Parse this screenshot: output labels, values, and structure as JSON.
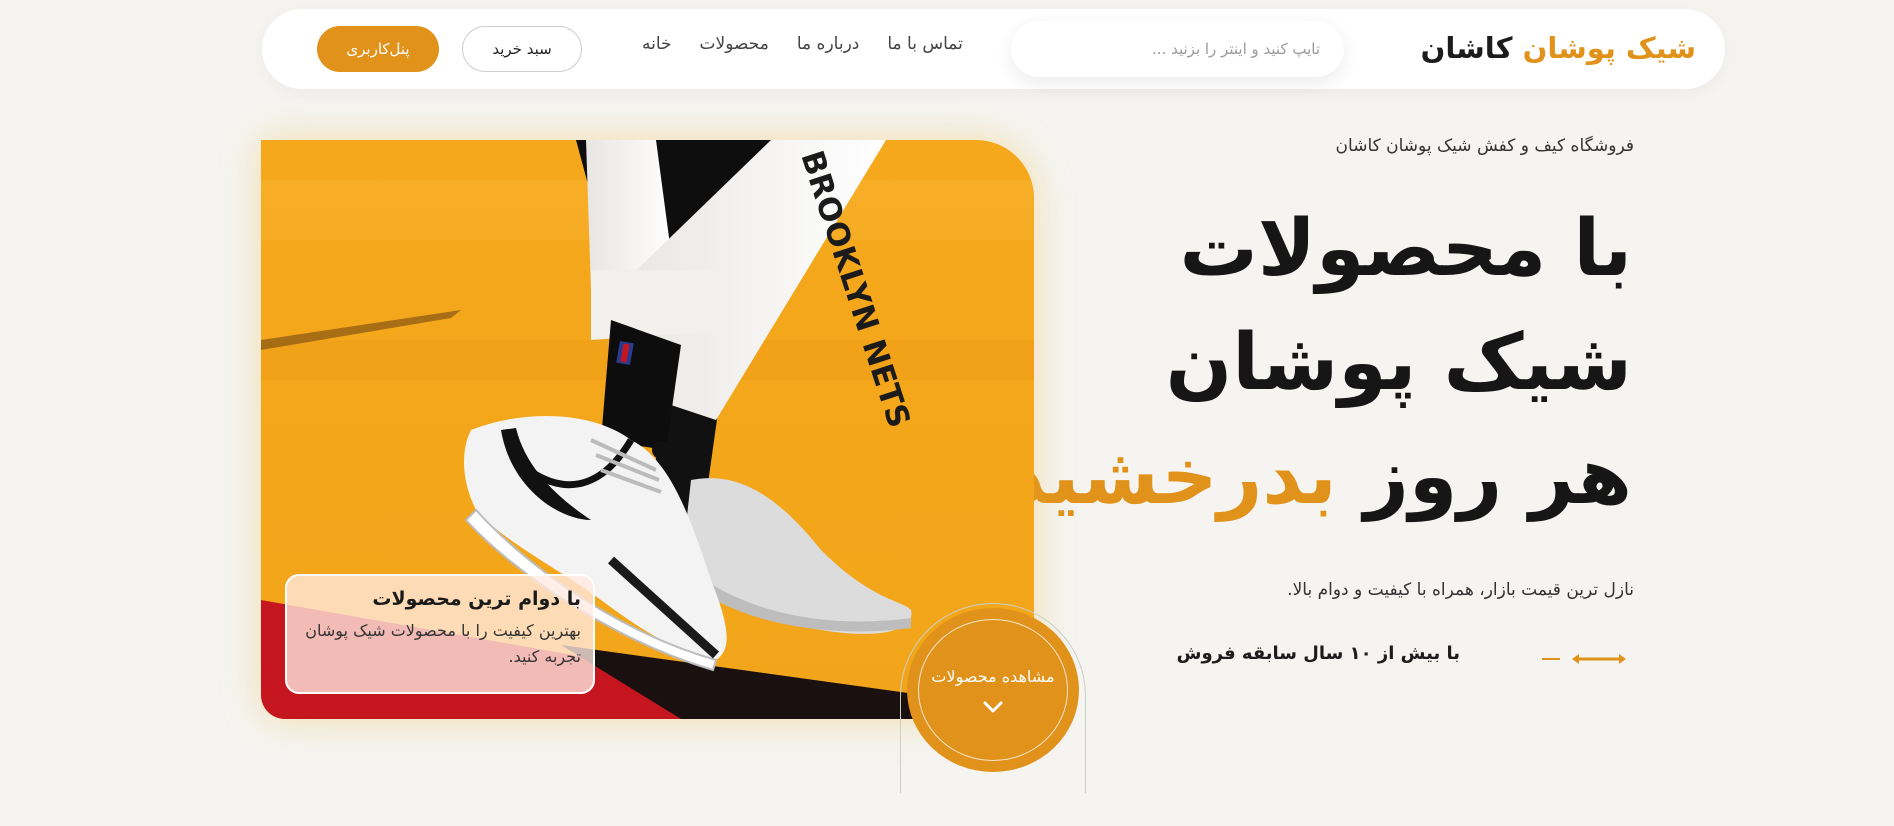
{
  "header": {
    "logo_accent": "شیک پوشان",
    "logo_rest": "کاشان",
    "search_placeholder": "تایپ کنید و اینتر را بزنید ...",
    "nav": [
      "خانه",
      "محصولات",
      "درباره ما",
      "تماس با ما"
    ],
    "cart_label": "سبد خرید",
    "panel_label": "پنل‌کاربری"
  },
  "hero": {
    "kicker": "فروشگاه کیف و کفش شیک پوشان کاشان",
    "headline_line1": "با محصولات",
    "headline_line2": "شیک پوشان",
    "headline_line3_plain": "هر روز",
    "headline_line3_accent": "بدرخشید",
    "headline_dot": ".",
    "subtext": "نازل ترین قیمت بازار، همراه با کیفیت و دوام بالا.",
    "years": "با بیش از ۱۰ سال سابقه فروش",
    "card_title": "با دوام ترین محصولات",
    "card_desc": "بهترین کیفیت را با محصولات شیک پوشان تجربه کنید.",
    "cta_label": "مشاهده محصولات",
    "image_text": "BROOKLYN NETS"
  },
  "colors": {
    "accent": "#e0921a",
    "background": "#f5f4f1",
    "text": "#161616"
  },
  "icons": {
    "cta": "chevron-down-icon",
    "deco": "arrow-line-icon"
  }
}
